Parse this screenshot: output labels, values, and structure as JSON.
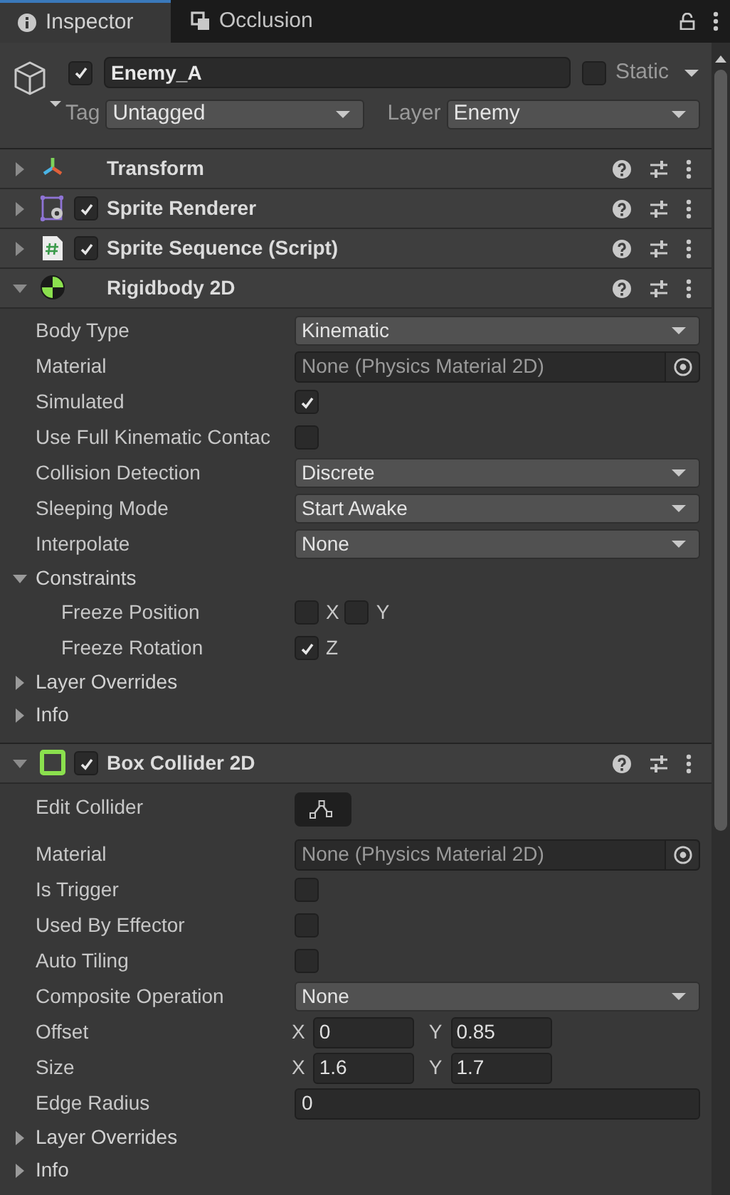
{
  "tabs": [
    {
      "label": "Inspector",
      "selected": true
    },
    {
      "label": "Occlusion",
      "selected": false
    }
  ],
  "object": {
    "active": true,
    "name": "Enemy_A",
    "static": false,
    "static_label": "Static",
    "tag_label": "Tag",
    "tag": "Untagged",
    "layer_label": "Layer",
    "layer": "Enemy"
  },
  "components": [
    {
      "title": "Transform",
      "kind": "transform",
      "expanded": false
    },
    {
      "title": "Sprite Renderer",
      "kind": "sprite_renderer",
      "expanded": false,
      "enabled": true
    },
    {
      "title": "Sprite Sequence (Script)",
      "kind": "script",
      "expanded": false,
      "enabled": true
    },
    {
      "title": "Rigidbody 2D",
      "kind": "rigidbody",
      "expanded": true,
      "rows": [
        {
          "kind": "dropdown",
          "label": "Body Type",
          "value": "Kinematic"
        },
        {
          "kind": "object",
          "label": "Material",
          "value": "None (Physics Material 2D)"
        },
        {
          "kind": "checkbox",
          "label": "Simulated",
          "checked": true
        },
        {
          "kind": "checkbox",
          "label": "Use Full Kinematic Contac",
          "checked": false
        },
        {
          "kind": "dropdown",
          "label": "Collision Detection",
          "value": "Discrete"
        },
        {
          "kind": "dropdown",
          "label": "Sleeping Mode",
          "value": "Start Awake"
        },
        {
          "kind": "dropdown",
          "label": "Interpolate",
          "value": "None"
        },
        {
          "kind": "foldout",
          "label": "Constraints",
          "expanded": true,
          "children": [
            {
              "kind": "axis_toggles",
              "label": "Freeze Position",
              "toggles": [
                {
                  "axis": "X",
                  "checked": false
                },
                {
                  "axis": "Y",
                  "checked": false
                }
              ]
            },
            {
              "kind": "axis_toggles",
              "label": "Freeze Rotation",
              "toggles": [
                {
                  "axis": "Z",
                  "checked": true
                }
              ]
            }
          ]
        },
        {
          "kind": "foldout",
          "label": "Layer Overrides",
          "expanded": false
        },
        {
          "kind": "foldout",
          "label": "Info",
          "expanded": false
        }
      ]
    },
    {
      "title": "Box Collider 2D",
      "kind": "box_collider",
      "expanded": true,
      "enabled": true,
      "rows": [
        {
          "kind": "edit_button",
          "label": "Edit Collider"
        },
        {
          "kind": "object",
          "label": "Material",
          "value": "None (Physics Material 2D)"
        },
        {
          "kind": "checkbox",
          "label": "Is Trigger",
          "checked": false
        },
        {
          "kind": "checkbox",
          "label": "Used By Effector",
          "checked": false
        },
        {
          "kind": "checkbox",
          "label": "Auto Tiling",
          "checked": false
        },
        {
          "kind": "dropdown",
          "label": "Composite Operation",
          "value": "None"
        },
        {
          "kind": "vector2",
          "label": "Offset",
          "fields": [
            {
              "axis": "X",
              "value": "0"
            },
            {
              "axis": "Y",
              "value": "0.85"
            }
          ]
        },
        {
          "kind": "vector2",
          "label": "Size",
          "fields": [
            {
              "axis": "X",
              "value": "1.6"
            },
            {
              "axis": "Y",
              "value": "1.7"
            }
          ]
        },
        {
          "kind": "text",
          "label": "Edge Radius",
          "value": "0"
        },
        {
          "kind": "foldout",
          "label": "Layer Overrides",
          "expanded": false
        },
        {
          "kind": "foldout",
          "label": "Info",
          "expanded": false
        }
      ]
    }
  ]
}
